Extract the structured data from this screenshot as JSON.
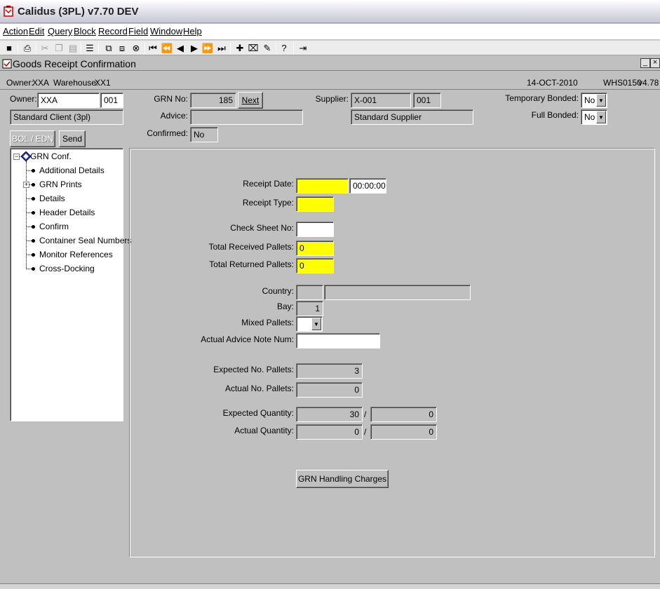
{
  "app": {
    "title": "Calidus (3PL) v7.70 DEV"
  },
  "menu": [
    "Action",
    "Edit",
    "Query",
    "Block",
    "Record",
    "Field",
    "Window",
    "Help"
  ],
  "window": {
    "title": "Goods Receipt Confirmation"
  },
  "info": {
    "owner_label": "Owner:",
    "owner": "XXA",
    "warehouse_label": "Warehouse:",
    "warehouse": "XX1",
    "date": "14-OCT-2010",
    "screen_id": "WHS0150",
    "version": "v4.78"
  },
  "header": {
    "owner_label": "Owner:",
    "owner_code": "XXA",
    "owner_suffix": "001",
    "owner_name": "Standard Client (3pl)",
    "grn_label": "GRN No:",
    "grn_no": "185",
    "next_label": "Next",
    "advice_label": "Advice:",
    "advice": "",
    "confirmed_label": "Confirmed:",
    "confirmed": "No",
    "supplier_label": "Supplier:",
    "supplier_code": "X-001",
    "supplier_suffix": "001",
    "supplier_name": "Standard Supplier",
    "temp_bonded_label": "Temporary Bonded:",
    "temp_bonded": "No",
    "full_bonded_label": "Full Bonded:",
    "full_bonded": "No"
  },
  "buttons": {
    "bol_edn": "BOL / EDN",
    "send": "Send",
    "handling": "GRN Handling Charges"
  },
  "tree": {
    "root": "GRN Conf.",
    "items": [
      "Additional Details",
      "GRN Prints",
      "Details",
      "Header Details",
      "Confirm",
      "Container Seal Numbers",
      "Monitor References",
      "Cross-Docking"
    ]
  },
  "form": {
    "receipt_date_label": "Receipt Date:",
    "receipt_date": "",
    "receipt_time": "00:00:00",
    "receipt_type_label": "Receipt Type:",
    "receipt_type": "",
    "check_sheet_label": "Check Sheet No:",
    "check_sheet": "",
    "total_received_label": "Total Received Pallets:",
    "total_received": "0",
    "total_returned_label": "Total Returned Pallets:",
    "total_returned": "0",
    "country_label": "Country:",
    "country_code": "",
    "country_name": "",
    "bay_label": "Bay:",
    "bay": "1",
    "mixed_label": "Mixed Pallets:",
    "mixed": "",
    "advice_note_label": "Actual Advice Note Num:",
    "advice_note": "",
    "exp_pallets_label": "Expected No. Pallets:",
    "exp_pallets": "3",
    "act_pallets_label": "Actual No. Pallets:",
    "act_pallets": "0",
    "exp_qty_label": "Expected Quantity:",
    "exp_qty": "30",
    "exp_qty2": "0",
    "act_qty_label": "Actual Quantity:",
    "act_qty": "0",
    "act_qty2": "0",
    "slash": "/"
  },
  "colors": {
    "required": "#ffff00",
    "background": "#c0c0c0"
  }
}
